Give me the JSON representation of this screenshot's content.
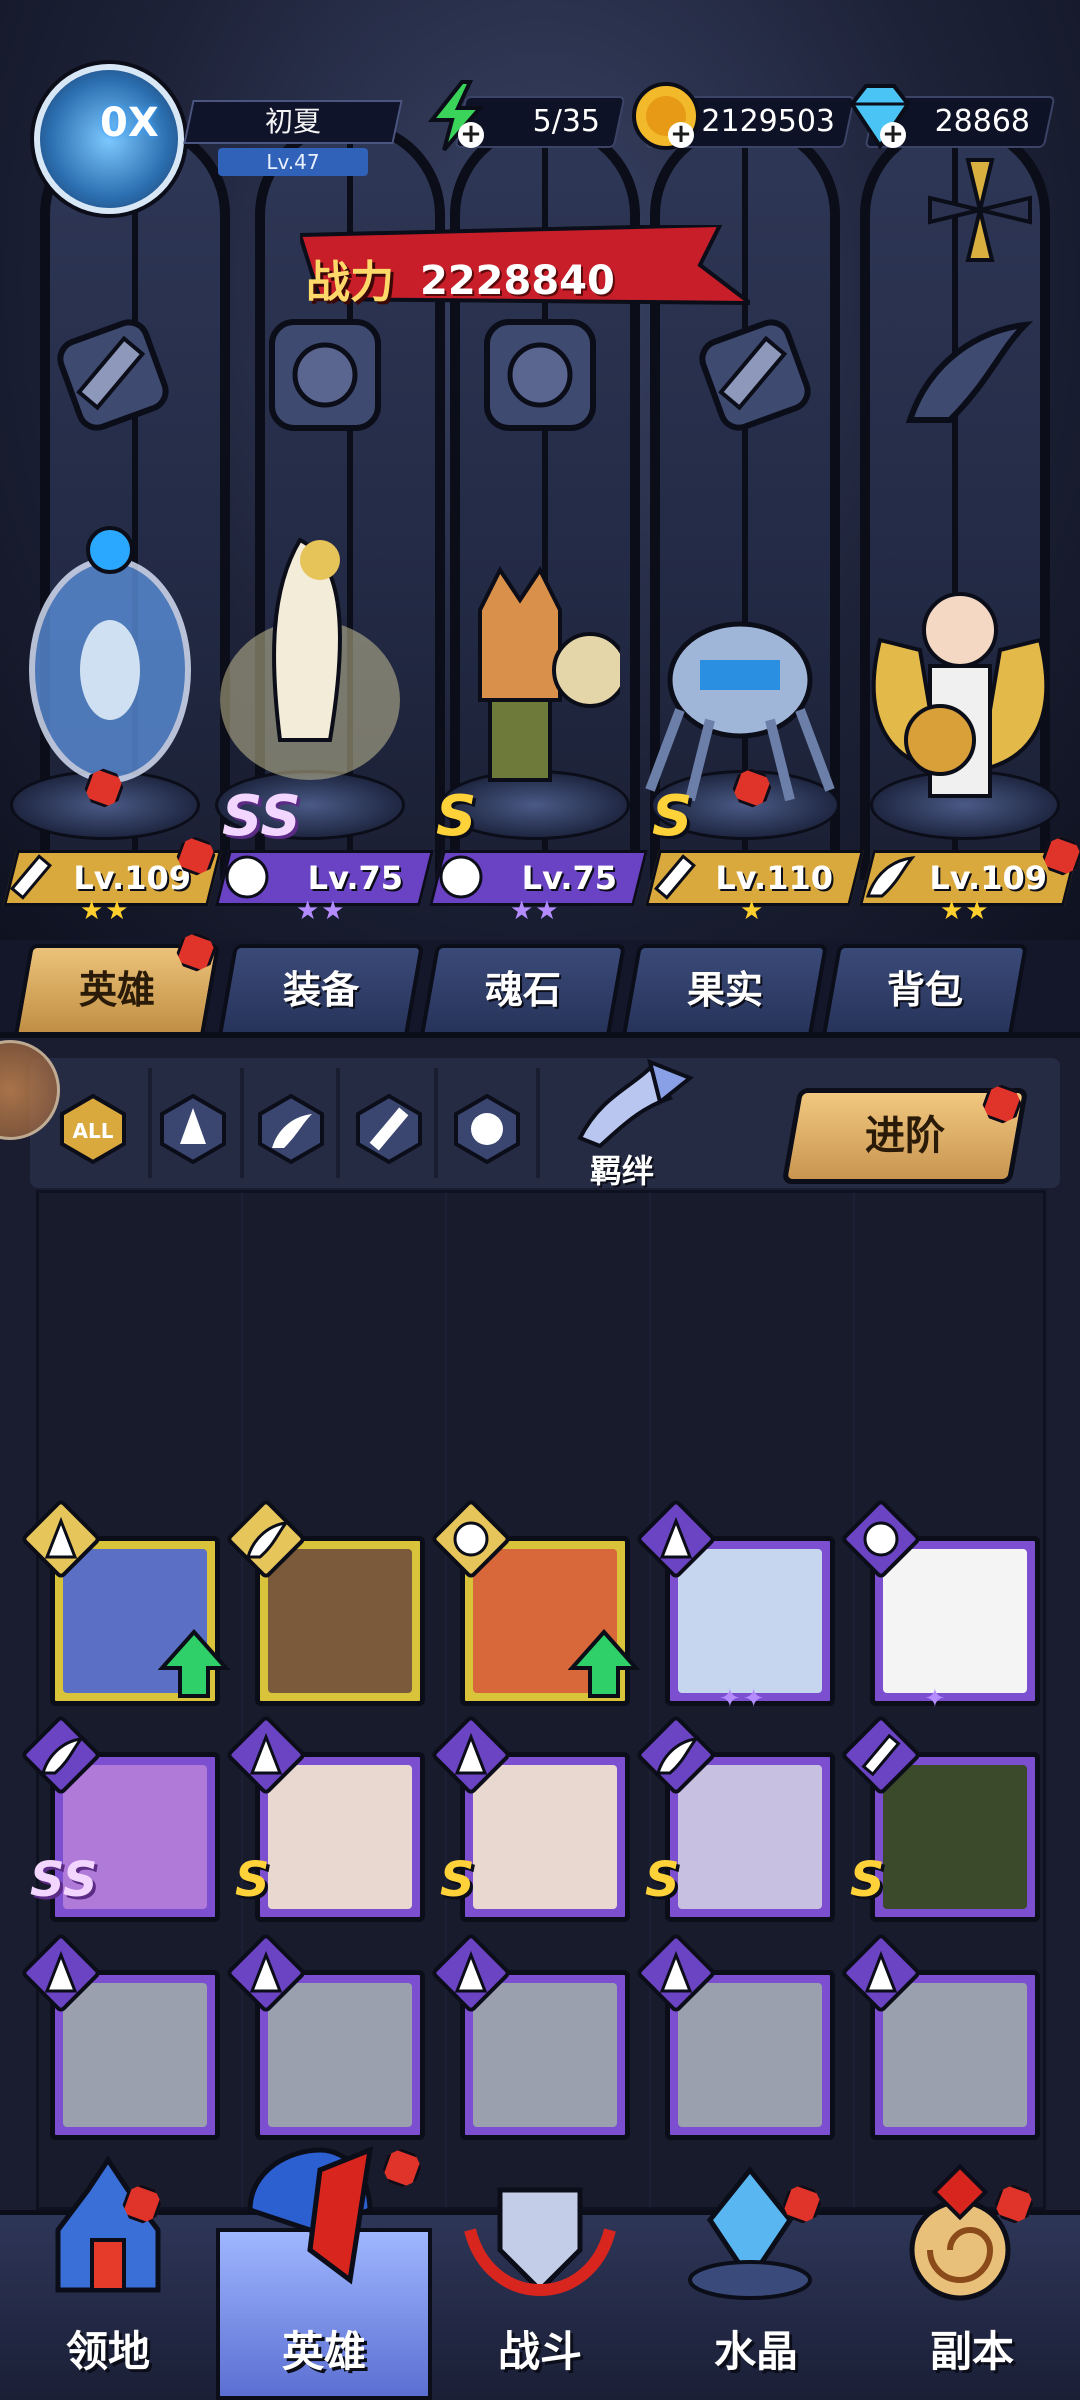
{
  "player": {
    "name": "初夏",
    "level": "Lv.47",
    "vip": "0X"
  },
  "resources": {
    "stamina": "5/35",
    "gold": "2129503",
    "diamonds": "28868"
  },
  "power": {
    "label": "战力",
    "value": "2228840"
  },
  "heroes_on_stage": [
    {
      "level": "Lv.109",
      "class_icon": "wrench-icon",
      "stars": "★★",
      "grade": "",
      "plate": "gold"
    },
    {
      "level": "Lv.75",
      "class_icon": "beast-icon",
      "stars": "★★",
      "grade": "SS",
      "plate": "purple"
    },
    {
      "level": "Lv.75",
      "class_icon": "beast-icon",
      "stars": "★★",
      "grade": "S",
      "plate": "purple"
    },
    {
      "level": "Lv.110",
      "class_icon": "wrench-icon",
      "stars": "★",
      "grade": "S",
      "plate": "gold"
    },
    {
      "level": "Lv.109",
      "class_icon": "wing-icon",
      "stars": "★★",
      "grade": "",
      "plate": "gold"
    }
  ],
  "main_tabs": [
    "英雄",
    "装备",
    "魂石",
    "果实",
    "背包"
  ],
  "filters": {
    "all": "ALL",
    "bond": "羁绊",
    "advance": "进阶"
  },
  "roster": [
    {
      "rarity": "gold",
      "class_icon": "mage-icon",
      "grade": "",
      "stars": "",
      "upgrade": true
    },
    {
      "rarity": "gold",
      "class_icon": "wing-icon",
      "grade": "",
      "stars": "",
      "upgrade": false
    },
    {
      "rarity": "gold",
      "class_icon": "beast-icon",
      "grade": "",
      "stars": "",
      "upgrade": true
    },
    {
      "rarity": "purple",
      "class_icon": "mage-icon",
      "grade": "",
      "stars": "✦✦",
      "upgrade": false
    },
    {
      "rarity": "purple",
      "class_icon": "beast-icon",
      "grade": "",
      "stars": "✦",
      "upgrade": false
    },
    {
      "rarity": "purple",
      "class_icon": "wing-icon",
      "grade": "SS",
      "stars": "",
      "upgrade": false
    },
    {
      "rarity": "purple",
      "class_icon": "mage-icon",
      "grade": "S",
      "stars": "",
      "upgrade": false
    },
    {
      "rarity": "purple",
      "class_icon": "mage-icon",
      "grade": "S",
      "stars": "",
      "upgrade": false
    },
    {
      "rarity": "purple",
      "class_icon": "wing-icon",
      "grade": "S",
      "stars": "",
      "upgrade": false
    },
    {
      "rarity": "purple",
      "class_icon": "wrench-icon",
      "grade": "S",
      "stars": "",
      "upgrade": false
    },
    {
      "rarity": "purple",
      "class_icon": "mage-icon",
      "grade": "",
      "stars": "",
      "upgrade": false
    },
    {
      "rarity": "purple",
      "class_icon": "mage-icon",
      "grade": "",
      "stars": "",
      "upgrade": false
    },
    {
      "rarity": "purple",
      "class_icon": "mage-icon",
      "grade": "",
      "stars": "",
      "upgrade": false
    },
    {
      "rarity": "purple",
      "class_icon": "mage-icon",
      "grade": "",
      "stars": "",
      "upgrade": false
    },
    {
      "rarity": "purple",
      "class_icon": "mage-icon",
      "grade": "",
      "stars": "",
      "upgrade": false
    }
  ],
  "bottom_nav": [
    "领地",
    "英雄",
    "战斗",
    "水晶",
    "副本"
  ],
  "colors": {
    "gold_rarity": "#d8c33a",
    "purple_rarity": "#7c4fd1",
    "notification": "#e0332a",
    "active_tab": "#ecc27a"
  }
}
